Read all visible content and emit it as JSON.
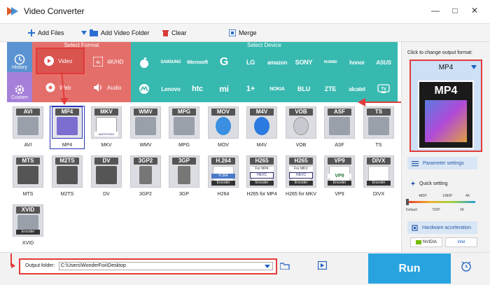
{
  "app": {
    "title": "Video Converter"
  },
  "window": {
    "minimize": "—",
    "maximize": "□",
    "close": "✕"
  },
  "toolbar": {
    "add_files": "Add Files",
    "add_folder": "Add Video Folder",
    "clear": "Clear",
    "merge": "Merge"
  },
  "nav": {
    "history": "History",
    "custom": "Custom"
  },
  "headers": {
    "select_format": "Select Format",
    "select_device": "Select Device"
  },
  "format_tabs": {
    "video": "Video",
    "hd": "4K/HD",
    "web": "Web",
    "audio": "Audio"
  },
  "devices": {
    "row1": [
      "",
      "SAMSUNG",
      "Microsoft",
      "G",
      "LG",
      "amazon",
      "SONY",
      "HUAWEI",
      "honor",
      "ASUS"
    ],
    "row2": [
      "",
      "Lenovo",
      "htc",
      "mi",
      "1+",
      "NOKIA",
      "BLU",
      "ZTE",
      "alcatel",
      "TV"
    ]
  },
  "formats": {
    "row1": [
      {
        "label": "AVI",
        "name": "AVI"
      },
      {
        "label": "MP4",
        "name": "MP4"
      },
      {
        "label": "MKV",
        "name": "MKV"
      },
      {
        "label": "WMV",
        "name": "WMV"
      },
      {
        "label": "MPG",
        "name": "MPG"
      },
      {
        "label": "MOV",
        "name": "MOV"
      },
      {
        "label": "M4V",
        "name": "M4V"
      },
      {
        "label": "VOB",
        "name": "VOB"
      },
      {
        "label": "ASF",
        "name": "ASF"
      },
      {
        "label": "TS",
        "name": "TS"
      }
    ],
    "row2": [
      {
        "label": "MTS",
        "name": "MTS"
      },
      {
        "label": "M2TS",
        "name": "M2TS"
      },
      {
        "label": "DV",
        "name": "DV"
      },
      {
        "label": "3GP2",
        "name": "3GP2"
      },
      {
        "label": "3GP",
        "name": "3GP"
      },
      {
        "label": "H.264",
        "name": "H264"
      },
      {
        "label": "H265",
        "name": "H265 for MP4"
      },
      {
        "label": "H265",
        "name": "H265 for MKV"
      },
      {
        "label": "VP9",
        "name": "VP9"
      },
      {
        "label": "DIVX",
        "name": "DIVX"
      }
    ],
    "row3": [
      {
        "label": "XVID",
        "name": "XVID"
      }
    ]
  },
  "format_sub": {
    "mkv": "MATROSKA",
    "h264": "H.264",
    "h265mp4_top": "For MP4",
    "h265mkv_top": "For MKV",
    "hevc": "HEVC",
    "encoder": "Encoder",
    "vp9": "VP9"
  },
  "right": {
    "caption": "Click to change output format:",
    "output_format": "MP4",
    "output_icon_label": "MP4",
    "parameter": "Parameter settings",
    "quick_setting": "Quick setting",
    "quick_labels": [
      "480P",
      "1080P",
      "4K"
    ],
    "quick_labels2": [
      "Default",
      "720P",
      "2K"
    ],
    "hardware": "Hardware acceleration",
    "nvidia": "NVIDIA",
    "intel": "intel"
  },
  "bottom": {
    "output_label": "Output folder:",
    "output_path": "C:\\Users\\WonderFox\\Desktop",
    "run": "Run"
  },
  "colors": {
    "accent": "#29a3e0",
    "highlight": "#e23b3b",
    "teal": "#37b9b0",
    "format_red": "#e46f6a",
    "nav_blue": "#5b93d2"
  }
}
